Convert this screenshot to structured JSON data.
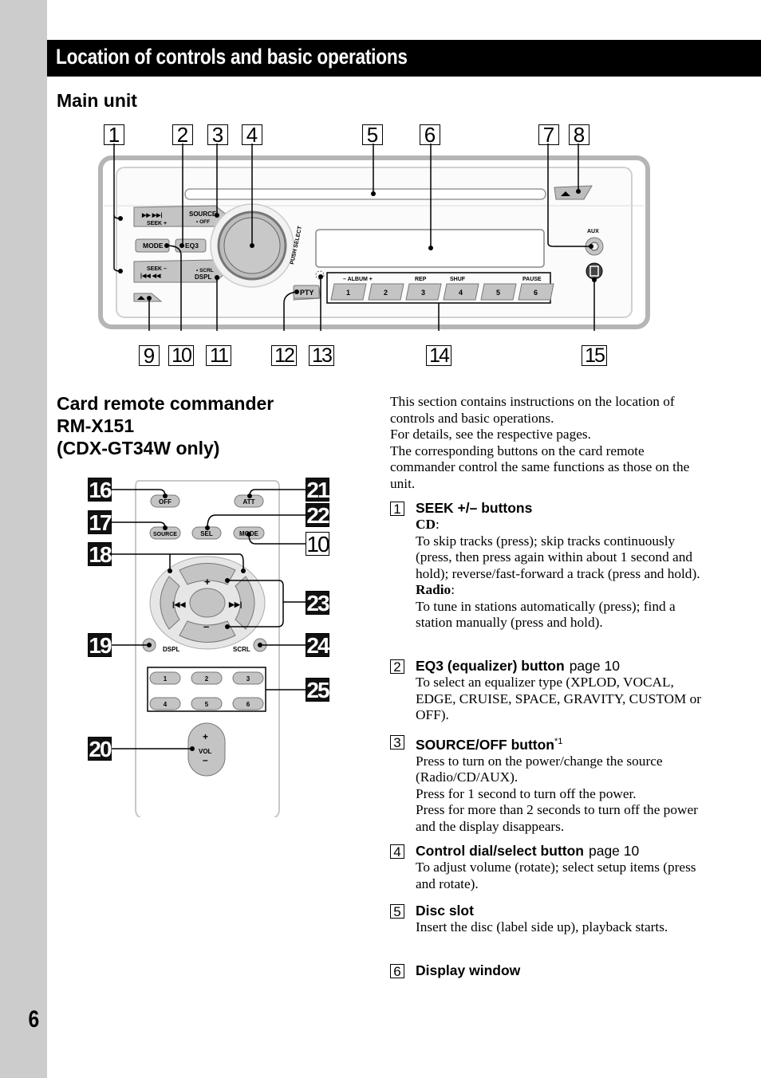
{
  "page_number": "6",
  "title": "Location of controls and basic operations",
  "main_unit": {
    "heading": "Main unit",
    "callouts_top": [
      "1",
      "2",
      "3",
      "4",
      "5",
      "6",
      "7",
      "8"
    ],
    "callouts_bottom": [
      "9",
      "10",
      "11",
      "12",
      "13",
      "14",
      "15"
    ],
    "labels": {
      "seek_plus": "SEEK +",
      "seek_minus": "SEEK –",
      "source": "SOURCE",
      "off": "• OFF",
      "mode": "MODE",
      "eq3": "EQ3",
      "scrl": "• SCRL",
      "dspl": "DSPL",
      "push_select": "PUSH SELECT",
      "pty": "PTY",
      "album": "–  ALBUM  +",
      "rep": "REP",
      "shuf": "SHUF",
      "pause": "PAUSE",
      "aux": "AUX",
      "presets": [
        "1",
        "2",
        "3",
        "4",
        "5",
        "6"
      ]
    }
  },
  "remote": {
    "heading_lines": [
      "Card remote commander",
      "RM-X151",
      "(CDX-GT34W only)"
    ],
    "callouts_left": [
      "16",
      "17",
      "18",
      "19",
      "20"
    ],
    "callouts_right": [
      "21",
      "22",
      "10",
      "23",
      "24",
      "25"
    ],
    "buttons": {
      "off": "OFF",
      "att": "ATT",
      "source": "SOURCE",
      "sel": "SEL",
      "mode": "MODE",
      "dspl": "DSPL",
      "scrl": "SCRL",
      "plus": "+",
      "minus": "–",
      "vol": "VOL",
      "vol_plus": "+",
      "vol_minus": "–",
      "numbers": [
        "1",
        "2",
        "3",
        "4",
        "5",
        "6"
      ]
    }
  },
  "intro": [
    "This section contains instructions on the location of controls and basic operations.",
    "For details, see the respective pages.",
    "The corresponding buttons on the card remote commander control the same functions as those on the unit."
  ],
  "items": [
    {
      "num": "1",
      "title": "SEEK +/– buttons",
      "cd_label": "CD",
      "cd_text": "To skip tracks (press); skip tracks continuously (press, then press again within about 1 second and hold); reverse/fast-forward a track (press and hold).",
      "radio_label": "Radio",
      "radio_text": "To tune in stations automatically (press); find a station manually (press and hold)."
    },
    {
      "num": "2",
      "title": "EQ3 (equalizer) button",
      "page_ref": "page 10",
      "text": "To select an equalizer type (XPLOD, VOCAL, EDGE, CRUISE, SPACE, GRAVITY, CUSTOM or OFF)."
    },
    {
      "num": "3",
      "title": "SOURCE/OFF button",
      "footnote": "*1",
      "lines": [
        "Press to turn on the power/change the source (Radio/CD/AUX).",
        "Press for 1 second to turn off the power.",
        "Press for more than 2 seconds to turn off the power and the display disappears."
      ]
    },
    {
      "num": "4",
      "title": "Control dial/select button",
      "page_ref": "page 10",
      "text": "To adjust volume (rotate); select setup items (press and rotate)."
    },
    {
      "num": "5",
      "title": "Disc slot",
      "text": "Insert the disc (label side up), playback starts."
    },
    {
      "num": "6",
      "title": "Display window"
    }
  ]
}
